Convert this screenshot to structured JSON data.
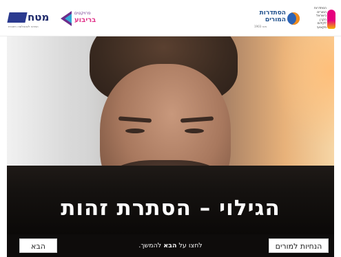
{
  "header": {
    "logo_matach": {
      "mark": "מטח",
      "tagline": "המרכז לטכנולוגיה חינוכית"
    },
    "logo_briut": {
      "line1": "פרויקטים",
      "line2": "בריבוע"
    },
    "logo_teachers": {
      "line1": "הסתדרות",
      "line2": "המורים",
      "sub": "מאז 1903"
    },
    "logo_fund": {
      "lines": [
        "הסתדרות",
        "המורים",
        "בישראל",
        "הקרן",
        "לקידום",
        "מקצועי"
      ]
    }
  },
  "slide": {
    "title": "הגילוי – הסתרת זהות"
  },
  "footer": {
    "next_label": "הבא",
    "hint_prefix": "לחצו על ",
    "hint_bold": "הבא",
    "hint_suffix": " להמשך.",
    "guide_label": "הנחיות למורים"
  },
  "colors": {
    "footer_bg": "#0e0c0b",
    "title_text": "#ffffff",
    "matach_blue": "#2b3a8f",
    "teachers_blue": "#1e4f8c",
    "briut_purple": "#6d2c8a",
    "briut_pink": "#e0338a"
  },
  "icons": {
    "matach": "matach-logo-icon",
    "briut": "chevron-logo-icon",
    "teachers": "circle-logo-icon",
    "fund": "figure-logo-icon"
  }
}
